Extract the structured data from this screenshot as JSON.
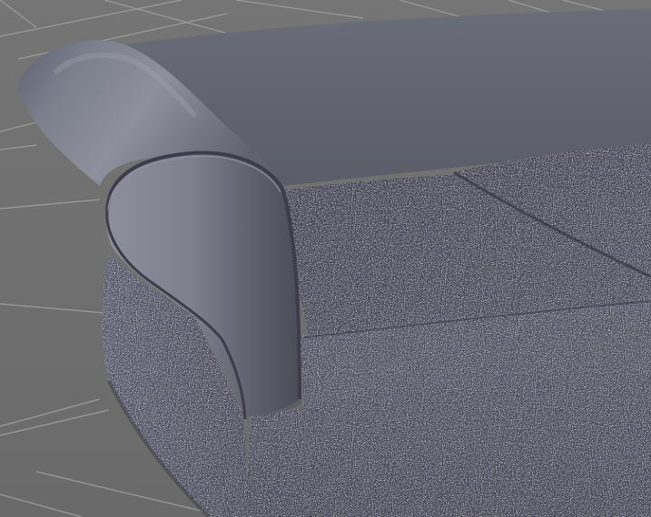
{
  "viewport": {
    "caption": ""
  },
  "scene": {
    "subject": "sofa",
    "colors": {
      "floor": "#6f6f6f",
      "grid_line": "#9a9a9a",
      "fabric_dark": "#3e3d4c",
      "fabric_light": "#a9a8be",
      "smooth_surface": "#5c5f69",
      "smooth_highlight": "#9a9ca8",
      "shadow": "#2a2a30"
    }
  }
}
